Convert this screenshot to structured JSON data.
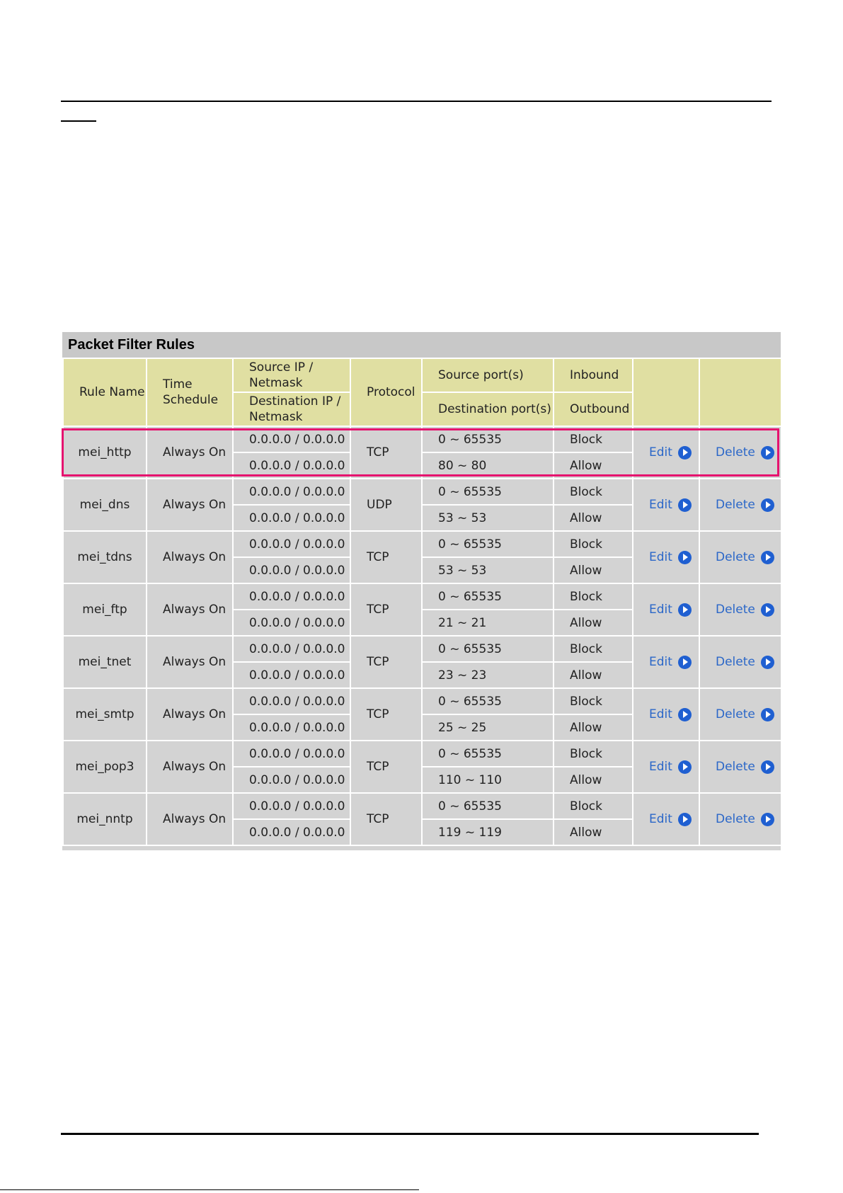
{
  "panel": {
    "title": "Packet Filter Rules",
    "headers": {
      "rule_name": "Rule Name",
      "time_schedule": "Time Schedule",
      "source_ip": "Source IP / Netmask",
      "destination_ip": "Destination IP / Netmask",
      "protocol": "Protocol",
      "source_ports": "Source port(s)",
      "destination_ports": "Destination port(s)",
      "inbound": "Inbound",
      "outbound": "Outbound"
    },
    "actions": {
      "edit": "Edit",
      "delete": "Delete"
    },
    "rows": [
      {
        "name": "mei_http",
        "schedule": "Always On",
        "src_ip": "0.0.0.0 / 0.0.0.0",
        "dst_ip": "0.0.0.0 / 0.0.0.0",
        "protocol": "TCP",
        "src_ports": "0 ~ 65535",
        "dst_ports": "80 ~ 80",
        "inbound": "Block",
        "outbound": "Allow"
      },
      {
        "name": "mei_dns",
        "schedule": "Always On",
        "src_ip": "0.0.0.0 / 0.0.0.0",
        "dst_ip": "0.0.0.0 / 0.0.0.0",
        "protocol": "UDP",
        "src_ports": "0 ~ 65535",
        "dst_ports": "53 ~ 53",
        "inbound": "Block",
        "outbound": "Allow"
      },
      {
        "name": "mei_tdns",
        "schedule": "Always On",
        "src_ip": "0.0.0.0 / 0.0.0.0",
        "dst_ip": "0.0.0.0 / 0.0.0.0",
        "protocol": "TCP",
        "src_ports": "0 ~ 65535",
        "dst_ports": "53 ~ 53",
        "inbound": "Block",
        "outbound": "Allow"
      },
      {
        "name": "mei_ftp",
        "schedule": "Always On",
        "src_ip": "0.0.0.0 / 0.0.0.0",
        "dst_ip": "0.0.0.0 / 0.0.0.0",
        "protocol": "TCP",
        "src_ports": "0 ~ 65535",
        "dst_ports": "21 ~ 21",
        "inbound": "Block",
        "outbound": "Allow"
      },
      {
        "name": "mei_tnet",
        "schedule": "Always On",
        "src_ip": "0.0.0.0 / 0.0.0.0",
        "dst_ip": "0.0.0.0 / 0.0.0.0",
        "protocol": "TCP",
        "src_ports": "0 ~ 65535",
        "dst_ports": "23 ~ 23",
        "inbound": "Block",
        "outbound": "Allow"
      },
      {
        "name": "mei_smtp",
        "schedule": "Always On",
        "src_ip": "0.0.0.0 / 0.0.0.0",
        "dst_ip": "0.0.0.0 / 0.0.0.0",
        "protocol": "TCP",
        "src_ports": "0 ~ 65535",
        "dst_ports": "25 ~ 25",
        "inbound": "Block",
        "outbound": "Allow"
      },
      {
        "name": "mei_pop3",
        "schedule": "Always On",
        "src_ip": "0.0.0.0 / 0.0.0.0",
        "dst_ip": "0.0.0.0 / 0.0.0.0",
        "protocol": "TCP",
        "src_ports": "0 ~ 65535",
        "dst_ports": "110 ~ 110",
        "inbound": "Block",
        "outbound": "Allow"
      },
      {
        "name": "mei_nntp",
        "schedule": "Always On",
        "src_ip": "0.0.0.0 / 0.0.0.0",
        "dst_ip": "0.0.0.0 / 0.0.0.0",
        "protocol": "TCP",
        "src_ports": "0 ~ 65535",
        "dst_ports": "119 ~ 119",
        "inbound": "Block",
        "outbound": "Allow"
      }
    ]
  },
  "colors": {
    "header_bg": "#e0dfa2",
    "row_bg": "#d3d3d3",
    "link": "#2b67c8",
    "highlight": "#e6136f"
  },
  "icons": {
    "action": "play-circle-icon"
  }
}
